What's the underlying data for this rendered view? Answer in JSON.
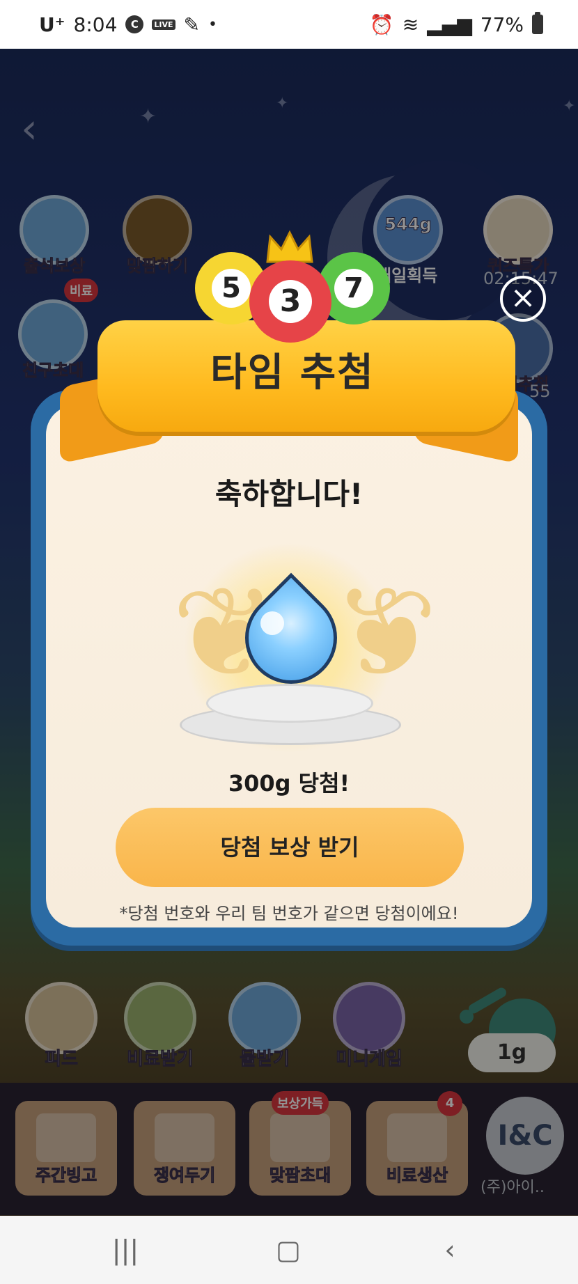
{
  "status_bar": {
    "carrier": "U⁺",
    "time": "8:04",
    "app_icon": "C",
    "live_badge": "LIVE",
    "battery": "77%"
  },
  "game": {
    "top_icons": [
      {
        "label": "출석보상"
      },
      {
        "label": "맞팜하기"
      },
      {
        "label": "544g",
        "sub": "매일획득"
      },
      {
        "label": "퀴즈특가",
        "sub": "02:15:47"
      }
    ],
    "side_icons": [
      {
        "label": "친구초대",
        "badge": "비료"
      },
      {
        "label": "타임추첨",
        "sub": "55"
      }
    ],
    "actions": [
      {
        "label": "피드"
      },
      {
        "label": "비료받기"
      },
      {
        "label": "물받기"
      },
      {
        "label": "미니게임"
      }
    ],
    "watering_amount": "1g",
    "tabs": [
      {
        "label": "주간빙고"
      },
      {
        "label": "쟁여두기"
      },
      {
        "label": "맞팜초대",
        "badge": "보상가득"
      },
      {
        "label": "비료생산",
        "badge": "4"
      }
    ],
    "corp_logo": "I&C",
    "corp_label": "(주)아이.."
  },
  "modal": {
    "title": "타임 추첨",
    "balls": [
      "5",
      "3",
      "7"
    ],
    "congrats": "축하합니다!",
    "prize": "300g 당첨!",
    "claim_label": "당첨 보상 받기",
    "notice": "*당첨 번호와 우리 팀 번호가 같으면 당첨이에요!"
  },
  "colors": {
    "ribbon": "#ffba1f",
    "modal_border": "#2b6ba4",
    "claim_button": "#f9b54a"
  }
}
